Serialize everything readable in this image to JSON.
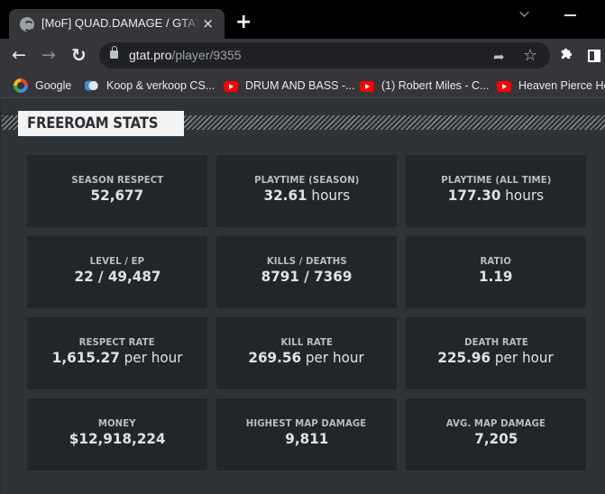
{
  "browser": {
    "tab_title": "[MoF] QUAD.DAMAGE / GTAT - GTAT",
    "tab_close": "×",
    "new_tab": "+",
    "url_host": "gtat.pro",
    "url_path": "/player/9355",
    "bookmarks": [
      {
        "label": "Google",
        "icon": "google-icon"
      },
      {
        "label": "Koop & verkoop CS...",
        "icon": "fish-icon"
      },
      {
        "label": "DRUM AND BASS -...",
        "icon": "youtube-icon"
      },
      {
        "label": "(1) Robert Miles - C...",
        "icon": "youtube-icon"
      },
      {
        "label": "Heaven Pierce Her",
        "icon": "youtube-icon"
      }
    ]
  },
  "section": {
    "title": "FREEROAM STATS"
  },
  "stats": [
    {
      "label": "SEASON RESPECT",
      "value": "52,677",
      "unit": ""
    },
    {
      "label": "PLAYTIME (SEASON)",
      "value": "32.61",
      "unit": "hours"
    },
    {
      "label": "PLAYTIME (ALL TIME)",
      "value": "177.30",
      "unit": "hours"
    },
    {
      "label": "LEVEL / EP",
      "value": "22 / 49,487",
      "unit": ""
    },
    {
      "label": "KILLS / DEATHS",
      "value": "8791 / 7369",
      "unit": ""
    },
    {
      "label": "RATIO",
      "value": "1.19",
      "unit": ""
    },
    {
      "label": "RESPECT RATE",
      "value": "1,615.27",
      "unit": "per hour"
    },
    {
      "label": "KILL RATE",
      "value": "269.56",
      "unit": "per hour"
    },
    {
      "label": "DEATH RATE",
      "value": "225.96",
      "unit": "per hour"
    },
    {
      "label": "MONEY",
      "value": "$12,918,224",
      "unit": ""
    },
    {
      "label": "HIGHEST MAP DAMAGE",
      "value": "9,811",
      "unit": ""
    },
    {
      "label": "AVG. MAP DAMAGE",
      "value": "7,205",
      "unit": ""
    }
  ]
}
